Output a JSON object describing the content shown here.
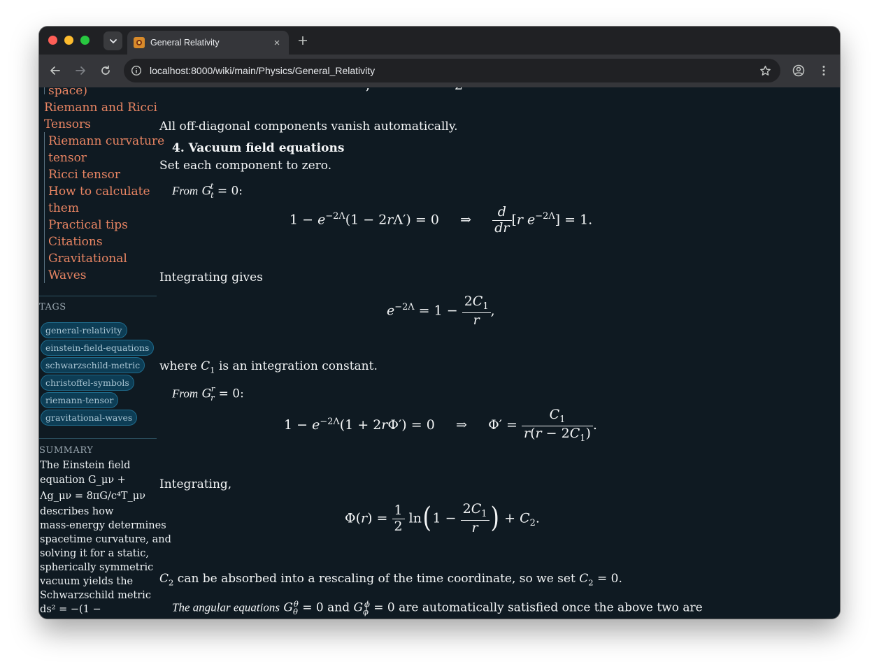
{
  "browser": {
    "tab_title": "General Relativity",
    "url": "localhost:8000/wiki/main/Physics/General_Relativity",
    "new_tab_symbol": "+",
    "close_symbol": "×"
  },
  "sidebar": {
    "toc": [
      {
        "label": "space)"
      },
      {
        "label": "Riemann and Ricci"
      },
      {
        "label": "Tensors"
      },
      {
        "label": "Riemann curvature"
      },
      {
        "label": "tensor"
      },
      {
        "label": "Ricci tensor"
      },
      {
        "label": "How to calculate"
      },
      {
        "label": "them"
      },
      {
        "label": "Practical tips"
      },
      {
        "label": "Citations"
      },
      {
        "label": "Gravitational"
      },
      {
        "label": "Waves"
      }
    ],
    "tags_heading": "TAGS",
    "tags": [
      "general-relativity",
      "einstein-field-equations",
      "schwarzschild-metric",
      "christoffel-symbols",
      "riemann-tensor",
      "gravitational-waves"
    ],
    "summary_heading": "SUMMARY",
    "summary_lines": [
      "The Einstein field",
      "equation G_μν +",
      "Λg_μν = 8πG/c⁴T_μν",
      "describes how",
      "mass-energy determines",
      "spacetime curvature, and",
      "solving it for a static,",
      "spherically symmetric",
      "vacuum yields the",
      "Schwarzschild metric",
      "ds² = −(1 −"
    ]
  },
  "article": {
    "offdiag_text": "All off-diagonal components vanish automatically.",
    "section_heading": "4. Vacuum field equations",
    "set_zero_text": "Set each component to zero.",
    "from_label": "From",
    "integrating_gives": "Integrating gives",
    "where_prefix": "where",
    "where_suffix": "is an integration constant.",
    "integrating": "Integrating,",
    "c2_text": "can be absorbed into a rescaling of the time coordinate, so we set",
    "angular_prefix": "The angular equations",
    "angular_and": "and",
    "angular_suffix": "are automatically satisfied once the above two are"
  }
}
